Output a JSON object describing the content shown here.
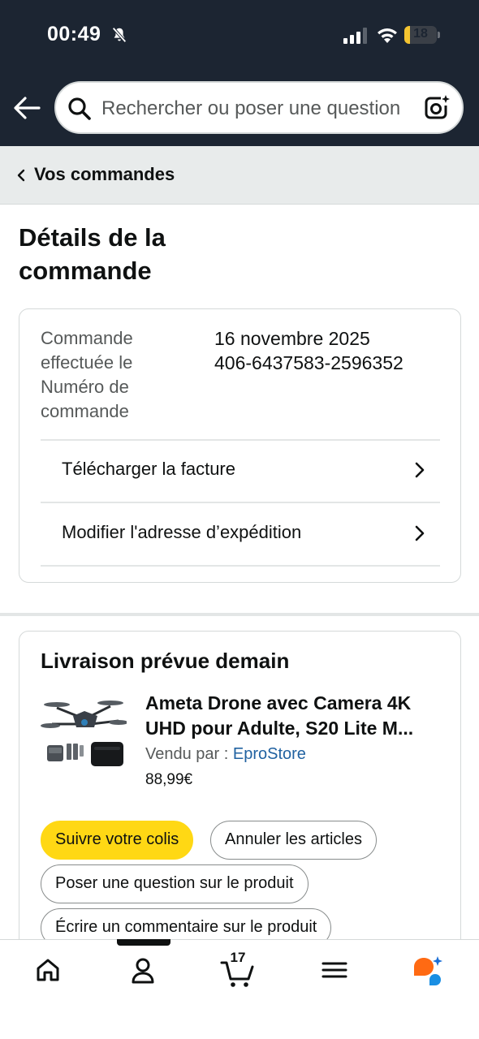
{
  "status_bar": {
    "time": "00:49",
    "battery_label": "18",
    "battery_level": 0.18,
    "battery_color": "#f4c430"
  },
  "header": {
    "background_color": "#1c2532",
    "back_icon": "arrow-left-icon",
    "search": {
      "placeholder": "Rechercher ou poser une question",
      "search_icon": "search-icon",
      "camera_icon": "camera-scan-icon"
    }
  },
  "breadcrumb": {
    "label": "Vos commandes"
  },
  "page": {
    "title": "Détails de la commande"
  },
  "order": {
    "placed_label": "Commande effectuée le",
    "placed_value": "16 novembre 2025",
    "number_label": "Numéro de commande",
    "number_value": "406-6437583-2596352",
    "links": [
      {
        "label": "Télécharger la facture"
      },
      {
        "label": "Modifier l'adresse d’expédition"
      }
    ]
  },
  "delivery": {
    "title": "Livraison prévue demain",
    "product": {
      "title_line1": "Ameta Drone avec Camera 4K",
      "title_line2": "UHD pour Adulte, S20 Lite M...",
      "sold_by_label": "Vendu par  :",
      "seller": "EproStore",
      "price": "88,99€"
    },
    "actions": [
      {
        "label": "Suivre votre colis",
        "primary": true
      },
      {
        "label": "Annuler les articles",
        "primary": false
      },
      {
        "label": "Poser une question sur le produit",
        "primary": false
      },
      {
        "label": "Écrire un commentaire sur le produit",
        "primary": false
      }
    ],
    "accent_button_color": "#ffd814",
    "link_color": "#2162a1"
  },
  "tabbar": {
    "tabs": [
      {
        "name": "home",
        "icon": "home-icon"
      },
      {
        "name": "account",
        "icon": "person-icon"
      },
      {
        "name": "cart",
        "icon": "cart-icon",
        "count": "17"
      },
      {
        "name": "menu",
        "icon": "menu-icon"
      },
      {
        "name": "rufus",
        "icon": "rufus-ai-icon"
      }
    ],
    "active_tab": "account"
  }
}
